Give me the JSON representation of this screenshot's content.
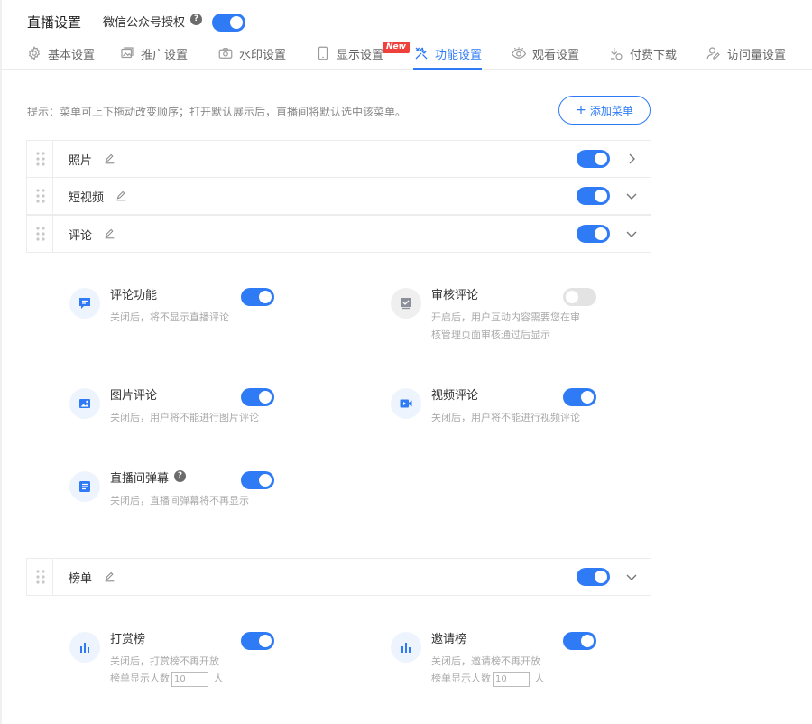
{
  "header": {
    "title": "直播设置",
    "auth_label": "微信公众号授权",
    "auth_enabled": true
  },
  "tabs": [
    {
      "label": "基本设置",
      "icon": "gear-icon"
    },
    {
      "label": "推广设置",
      "icon": "image-icon"
    },
    {
      "label": "水印设置",
      "icon": "camera-icon"
    },
    {
      "label": "显示设置",
      "icon": "tablet-icon",
      "badge": "New"
    },
    {
      "label": "功能设置",
      "icon": "tools-icon",
      "active": true
    },
    {
      "label": "观看设置",
      "icon": "eye-icon"
    },
    {
      "label": "付费下载",
      "icon": "coin-icon"
    },
    {
      "label": "访问量设置",
      "icon": "user-icon"
    }
  ],
  "hint": "提示：菜单可上下拖动改变顺序；打开默认展示后，直播间将默认选中该菜单。",
  "add_menu_label": "添加菜单",
  "menus": [
    {
      "label": "照片",
      "enabled": true,
      "expanded": false
    },
    {
      "label": "短视频",
      "enabled": true,
      "expanded": true
    },
    {
      "label": "评论",
      "enabled": true,
      "expanded": true
    },
    {
      "label": "榜单",
      "enabled": true,
      "expanded": true
    }
  ],
  "comment_features": [
    {
      "title": "评论功能",
      "desc": "关闭后，将不显示直播评论",
      "enabled": true,
      "icon": "comment-icon"
    },
    {
      "title": "审核评论",
      "desc_line1": "开启后，用户互动内容需要您在审",
      "desc_line2": "核管理页面审核通过后显示",
      "enabled": false,
      "icon": "review-icon"
    },
    {
      "title": "图片评论",
      "desc": "关闭后，用户将不能进行图片评论",
      "enabled": true,
      "icon": "picture-icon"
    },
    {
      "title": "视频评论",
      "desc": "关闭后，用户将不能进行视频评论",
      "enabled": true,
      "icon": "video-icon"
    },
    {
      "title": "直播间弹幕",
      "desc": "关闭后，直播间弹幕将不再显示",
      "enabled": true,
      "icon": "barrage-icon"
    }
  ],
  "rank_features": [
    {
      "title": "打赏榜",
      "desc": "关闭后，打赏榜不再开放",
      "count_label": "榜单显示人数",
      "count_value": "10",
      "unit": "人",
      "enabled": true,
      "icon": "bar-chart-icon"
    },
    {
      "title": "邀请榜",
      "desc": "关闭后，邀请榜不再开放",
      "count_label": "榜单显示人数",
      "count_value": "10",
      "unit": "人",
      "enabled": true,
      "icon": "bar-chart-icon"
    }
  ],
  "colors": {
    "accent": "#2f7bf5",
    "badge": "#f0403c"
  }
}
